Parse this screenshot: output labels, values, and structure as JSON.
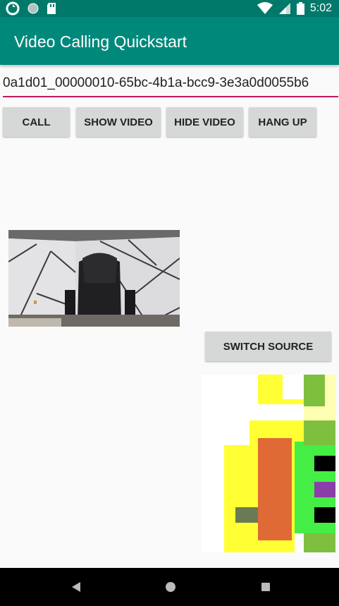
{
  "status_bar": {
    "time": "5:02",
    "icons": [
      "sync-icon",
      "circle-icon",
      "sd-card-icon",
      "wifi-icon",
      "signal-icon",
      "battery-icon"
    ]
  },
  "app_bar": {
    "title": "Video Calling Quickstart"
  },
  "callee": {
    "value": "0a1d01_00000010-65bc-4b1a-bcc9-3e3a0d0055b6"
  },
  "buttons": {
    "call": "CALL",
    "show_video": "SHOW VIDEO",
    "hide_video": "HIDE VIDEO",
    "hang_up": "HANG UP",
    "switch_source": "SWITCH SOURCE"
  },
  "nav_bar": {
    "icons": [
      "back-icon",
      "home-icon",
      "recents-icon"
    ]
  },
  "colors": {
    "status_bar": "#00796b",
    "app_bar": "#00897b",
    "input_underline": "#c2185b",
    "button": "#d6d7d7",
    "background": "#fafafa"
  }
}
